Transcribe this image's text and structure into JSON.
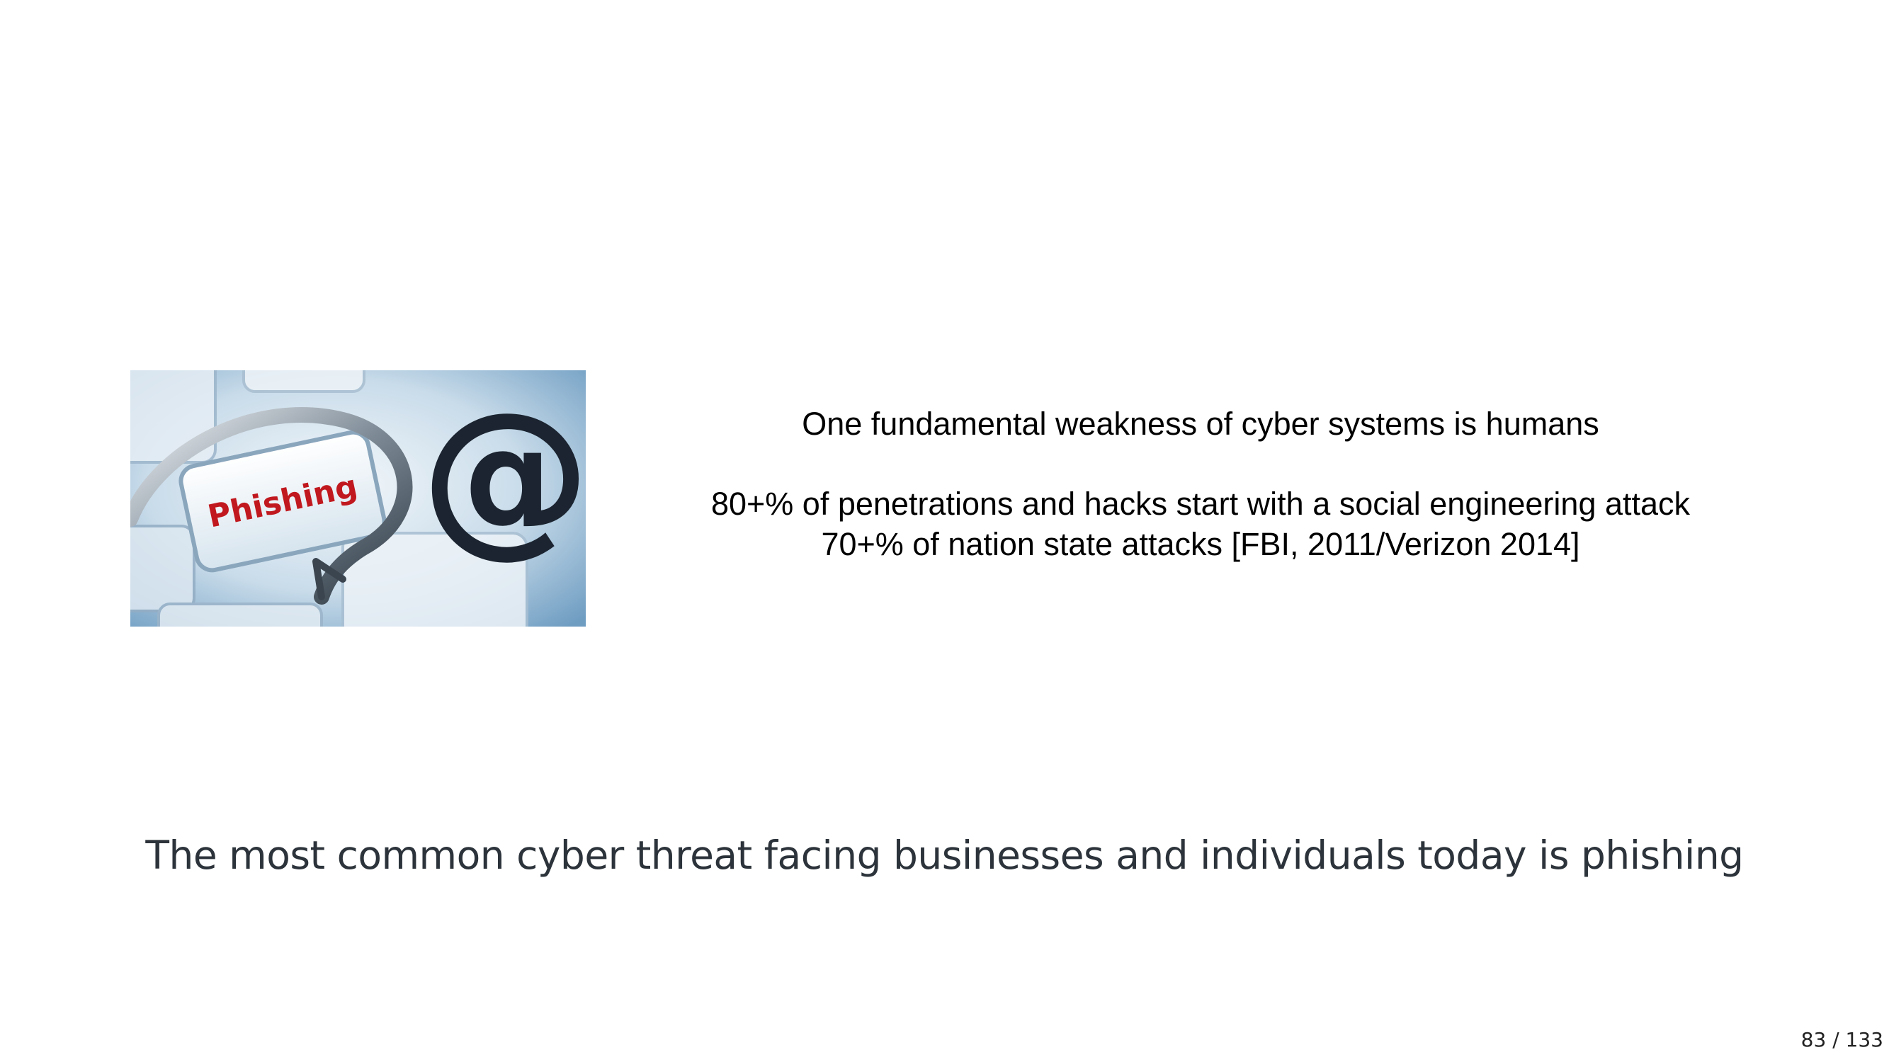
{
  "slide": {
    "image": {
      "icon": "phishing-hook-keyboard-image",
      "key_label": "Phishing",
      "at_symbol": "@",
      "colors": {
        "key_text": "#c0181e",
        "at_symbol": "#1b2430",
        "background": "#9fc2dc"
      }
    },
    "body_lines": [
      "One fundamental weakness of cyber systems is humans",
      "80+% of penetrations and hacks start with a social engineering attack",
      "70+% of nation state attacks [FBI, 2011/Verizon 2014]"
    ],
    "caption": "The most common cyber threat facing businesses and individuals today is phishing"
  },
  "pagination": {
    "current": "83",
    "separator": "/",
    "total": "133"
  }
}
